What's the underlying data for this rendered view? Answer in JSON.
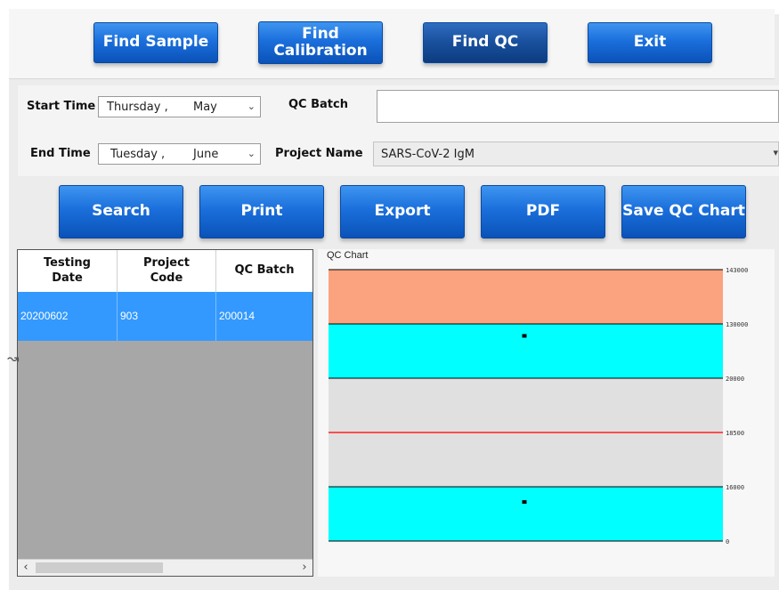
{
  "toolbar": {
    "find_sample": "Find Sample",
    "find_calibration": [
      "Find",
      "Calibration"
    ],
    "find_qc": "Find QC",
    "exit": "Exit"
  },
  "filters": {
    "start_time_label": "Start Time",
    "start_day": "Thursday ,",
    "start_month": "May",
    "end_time_label": "End Time",
    "end_day": "Tuesday ,",
    "end_month": "June",
    "qc_batch_label": "QC Batch",
    "qc_batch_value": "",
    "project_name_label": "Project Name",
    "project_name_value": "SARS-CoV-2 IgM"
  },
  "actions": {
    "search": "Search",
    "print": "Print",
    "export": "Export",
    "pdf": "PDF",
    "save_chart": "Save QC Chart"
  },
  "table": {
    "headers": [
      [
        "Testing",
        "Date"
      ],
      [
        "Project",
        "Code"
      ],
      [
        "QC Batch"
      ]
    ],
    "rows": [
      [
        "20200602",
        "903",
        "200014"
      ]
    ]
  },
  "chart_data": {
    "type": "scatter",
    "title": "QC Chart",
    "y_tick_labels": [
      "143000",
      "130000",
      "20000",
      "18500",
      "16000",
      "0"
    ],
    "bands": [
      {
        "from": "130000",
        "to": "143000",
        "color": "#fba27f"
      },
      {
        "from": "20000",
        "to": "130000",
        "color": "#00ffff"
      },
      {
        "from": "16000",
        "to": "20000",
        "color": "#e0e0e0"
      },
      {
        "from": "0",
        "to": "16000",
        "color": "#00ffff"
      }
    ],
    "center_line": {
      "value": "18500",
      "color": "#ff2020"
    },
    "points": [
      {
        "band_index": 1,
        "position_in_band": 0.22
      },
      {
        "band_index": 3,
        "position_in_band": 0.28
      }
    ],
    "grid": false
  },
  "colors": {
    "accent": "#1b6fdc",
    "selected_row": "#3399ff",
    "grid_body": "#a7a7a7"
  }
}
